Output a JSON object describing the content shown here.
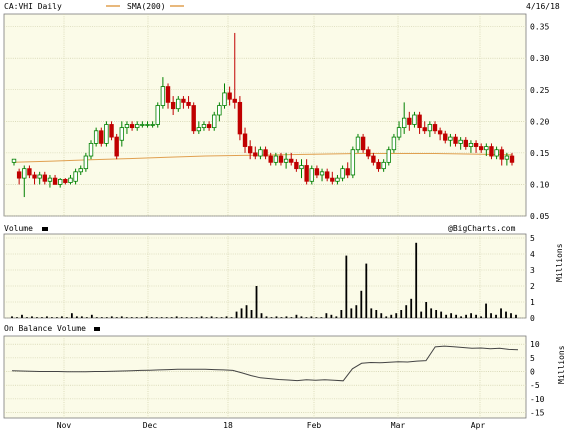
{
  "header": {
    "ticker_label": "CA:VHI Daily",
    "sma_label": "SMA(200)",
    "date": "4/16/18",
    "watermark": "@BigCharts.com"
  },
  "colors": {
    "up": "#008000",
    "down": "#c00000",
    "sma": "#e0a050",
    "bg": "#fbfbe8"
  },
  "chart_data": [
    {
      "type": "candlestick",
      "title": "CA:VHI Daily",
      "ylim": [
        0.05,
        0.37
      ],
      "y_ticks": [
        "0.05",
        "0.10",
        "0.15",
        "0.20",
        "0.25",
        "0.30",
        "0.35"
      ],
      "x_tick_labels": [
        "Nov",
        "Dec",
        "18",
        "Feb",
        "Mar",
        "Apr"
      ],
      "grid": true,
      "series": [
        {
          "name": "SMA(200)",
          "values": [
            0.135,
            0.137,
            0.139,
            0.141,
            0.143,
            0.145,
            0.146,
            0.147,
            0.148,
            0.149,
            0.149,
            0.149,
            0.148,
            0.147
          ]
        },
        {
          "values": [
            [
              0.135,
              0.14,
              0.13,
              0.14
            ],
            [
              0.12,
              0.125,
              0.1,
              0.11
            ],
            [
              0.11,
              0.13,
              0.08,
              0.125
            ],
            [
              0.125,
              0.13,
              0.11,
              0.115
            ],
            [
              0.115,
              0.12,
              0.1,
              0.11
            ],
            [
              0.11,
              0.12,
              0.1,
              0.115
            ],
            [
              0.115,
              0.12,
              0.1,
              0.105
            ],
            [
              0.105,
              0.115,
              0.095,
              0.11
            ],
            [
              0.11,
              0.115,
              0.1,
              0.1
            ],
            [
              0.1,
              0.11,
              0.095,
              0.108
            ],
            [
              0.108,
              0.11,
              0.1,
              0.103
            ],
            [
              0.103,
              0.115,
              0.1,
              0.11
            ],
            [
              0.105,
              0.125,
              0.1,
              0.12
            ],
            [
              0.12,
              0.13,
              0.115,
              0.125
            ],
            [
              0.125,
              0.15,
              0.12,
              0.145
            ],
            [
              0.145,
              0.17,
              0.14,
              0.165
            ],
            [
              0.165,
              0.19,
              0.16,
              0.185
            ],
            [
              0.185,
              0.19,
              0.16,
              0.165
            ],
            [
              0.165,
              0.2,
              0.16,
              0.195
            ],
            [
              0.195,
              0.2,
              0.17,
              0.175
            ],
            [
              0.175,
              0.18,
              0.14,
              0.145
            ],
            [
              0.17,
              0.2,
              0.16,
              0.19
            ],
            [
              0.19,
              0.2,
              0.18,
              0.195
            ],
            [
              0.195,
              0.2,
              0.185,
              0.19
            ],
            [
              0.19,
              0.2,
              0.185,
              0.195
            ],
            [
              0.195,
              0.2,
              0.19,
              0.195
            ],
            [
              0.195,
              0.2,
              0.19,
              0.195
            ],
            [
              0.195,
              0.2,
              0.19,
              0.195
            ],
            [
              0.195,
              0.23,
              0.19,
              0.225
            ],
            [
              0.225,
              0.27,
              0.22,
              0.255
            ],
            [
              0.255,
              0.26,
              0.22,
              0.23
            ],
            [
              0.23,
              0.24,
              0.21,
              0.22
            ],
            [
              0.22,
              0.24,
              0.215,
              0.235
            ],
            [
              0.235,
              0.24,
              0.22,
              0.23
            ],
            [
              0.23,
              0.24,
              0.22,
              0.225
            ],
            [
              0.225,
              0.23,
              0.18,
              0.185
            ],
            [
              0.185,
              0.2,
              0.18,
              0.19
            ],
            [
              0.19,
              0.2,
              0.185,
              0.195
            ],
            [
              0.195,
              0.2,
              0.185,
              0.19
            ],
            [
              0.19,
              0.215,
              0.185,
              0.21
            ],
            [
              0.21,
              0.23,
              0.2,
              0.225
            ],
            [
              0.225,
              0.26,
              0.22,
              0.245
            ],
            [
              0.245,
              0.255,
              0.225,
              0.235
            ],
            [
              0.235,
              0.34,
              0.22,
              0.23
            ],
            [
              0.23,
              0.24,
              0.17,
              0.18
            ],
            [
              0.18,
              0.19,
              0.15,
              0.16
            ],
            [
              0.16,
              0.17,
              0.14,
              0.15
            ],
            [
              0.15,
              0.16,
              0.14,
              0.145
            ],
            [
              0.145,
              0.16,
              0.14,
              0.155
            ],
            [
              0.155,
              0.16,
              0.14,
              0.145
            ],
            [
              0.145,
              0.15,
              0.13,
              0.135
            ],
            [
              0.135,
              0.15,
              0.13,
              0.145
            ],
            [
              0.145,
              0.15,
              0.13,
              0.135
            ],
            [
              0.135,
              0.15,
              0.125,
              0.14
            ],
            [
              0.14,
              0.15,
              0.13,
              0.135
            ],
            [
              0.135,
              0.14,
              0.12,
              0.125
            ],
            [
              0.125,
              0.14,
              0.11,
              0.13
            ],
            [
              0.13,
              0.14,
              0.1,
              0.105
            ],
            [
              0.105,
              0.13,
              0.1,
              0.125
            ],
            [
              0.125,
              0.13,
              0.11,
              0.115
            ],
            [
              0.115,
              0.125,
              0.105,
              0.12
            ],
            [
              0.12,
              0.125,
              0.105,
              0.11
            ],
            [
              0.11,
              0.12,
              0.1,
              0.105
            ],
            [
              0.105,
              0.115,
              0.1,
              0.11
            ],
            [
              0.11,
              0.13,
              0.105,
              0.125
            ],
            [
              0.125,
              0.135,
              0.11,
              0.115
            ],
            [
              0.115,
              0.16,
              0.11,
              0.155
            ],
            [
              0.155,
              0.18,
              0.15,
              0.175
            ],
            [
              0.175,
              0.18,
              0.15,
              0.155
            ],
            [
              0.155,
              0.16,
              0.14,
              0.145
            ],
            [
              0.145,
              0.15,
              0.13,
              0.135
            ],
            [
              0.135,
              0.14,
              0.12,
              0.125
            ],
            [
              0.125,
              0.14,
              0.12,
              0.135
            ],
            [
              0.135,
              0.16,
              0.13,
              0.155
            ],
            [
              0.155,
              0.18,
              0.15,
              0.175
            ],
            [
              0.175,
              0.2,
              0.17,
              0.19
            ],
            [
              0.19,
              0.23,
              0.18,
              0.205
            ],
            [
              0.205,
              0.215,
              0.185,
              0.195
            ],
            [
              0.195,
              0.215,
              0.19,
              0.21
            ],
            [
              0.21,
              0.215,
              0.18,
              0.19
            ],
            [
              0.19,
              0.2,
              0.18,
              0.185
            ],
            [
              0.185,
              0.2,
              0.175,
              0.195
            ],
            [
              0.195,
              0.2,
              0.18,
              0.185
            ],
            [
              0.185,
              0.19,
              0.17,
              0.18
            ],
            [
              0.18,
              0.185,
              0.165,
              0.17
            ],
            [
              0.17,
              0.18,
              0.16,
              0.175
            ],
            [
              0.175,
              0.18,
              0.16,
              0.165
            ],
            [
              0.165,
              0.175,
              0.155,
              0.17
            ],
            [
              0.17,
              0.175,
              0.155,
              0.16
            ],
            [
              0.16,
              0.17,
              0.15,
              0.165
            ],
            [
              0.165,
              0.17,
              0.15,
              0.16
            ],
            [
              0.16,
              0.165,
              0.15,
              0.155
            ],
            [
              0.155,
              0.165,
              0.145,
              0.16
            ],
            [
              0.16,
              0.165,
              0.14,
              0.145
            ],
            [
              0.145,
              0.16,
              0.14,
              0.155
            ],
            [
              0.155,
              0.16,
              0.13,
              0.14
            ],
            [
              0.14,
              0.15,
              0.13,
              0.145
            ],
            [
              0.145,
              0.15,
              0.13,
              0.135
            ]
          ]
        }
      ]
    },
    {
      "type": "bar",
      "title": "Volume",
      "ylabel": "Millions",
      "ylim": [
        0,
        5
      ],
      "y_ticks": [
        "0",
        "1",
        "2",
        "3",
        "4",
        "5"
      ],
      "values": [
        0.1,
        0.05,
        0.2,
        0.05,
        0.1,
        0.05,
        0.05,
        0.1,
        0.05,
        0.05,
        0.1,
        0.05,
        0.3,
        0.1,
        0.1,
        0.05,
        0.2,
        0.05,
        0.05,
        0.05,
        0.1,
        0.05,
        0.1,
        0.05,
        0.05,
        0.05,
        0.05,
        0.1,
        0.05,
        0.05,
        0.05,
        0.05,
        0.05,
        0.1,
        0.05,
        0.05,
        0.05,
        0.05,
        0.1,
        0.05,
        0.1,
        0.05,
        0.05,
        0.1,
        0.05,
        0.4,
        0.6,
        0.8,
        0.5,
        2.0,
        0.3,
        0.1,
        0.05,
        0.1,
        0.05,
        0.1,
        0.05,
        0.2,
        0.1,
        0.05,
        0.1,
        0.05,
        0.05,
        0.3,
        0.2,
        0.1,
        0.5,
        3.9,
        0.6,
        0.8,
        1.7,
        3.4,
        0.6,
        0.5,
        0.3,
        0.1,
        0.2,
        0.3,
        0.5,
        0.8,
        1.2,
        4.7,
        0.4,
        1.0,
        0.6,
        0.5,
        0.4,
        0.2,
        0.3,
        0.2,
        0.1,
        0.2,
        0.3,
        0.2,
        0.1,
        0.9,
        0.3,
        0.2,
        0.6,
        0.4,
        0.3,
        0.2
      ]
    },
    {
      "type": "line",
      "title": "On Balance Volume",
      "ylabel": "Millions",
      "ylim": [
        -17,
        13
      ],
      "y_ticks": [
        "10",
        "5",
        "0",
        "-5",
        "-10",
        "-15"
      ],
      "values": [
        0.3,
        0.2,
        0.1,
        0.0,
        0.0,
        0.0,
        -0.1,
        -0.1,
        -0.1,
        0.0,
        0.0,
        0.1,
        0.2,
        0.3,
        0.4,
        0.5,
        0.6,
        0.7,
        0.8,
        0.8,
        0.8,
        0.8,
        0.7,
        0.6,
        0.4,
        -0.5,
        -1.5,
        -2.3,
        -2.6,
        -2.9,
        -3.1,
        -3.3,
        -3.0,
        -3.2,
        -3.0,
        -3.2,
        -3.4,
        1.0,
        3.0,
        3.3,
        3.2,
        3.4,
        3.6,
        3.5,
        3.8,
        4.0,
        9.0,
        9.3,
        9.1,
        8.8,
        8.5,
        8.6,
        8.3,
        8.5,
        8.1,
        8.0
      ]
    }
  ]
}
